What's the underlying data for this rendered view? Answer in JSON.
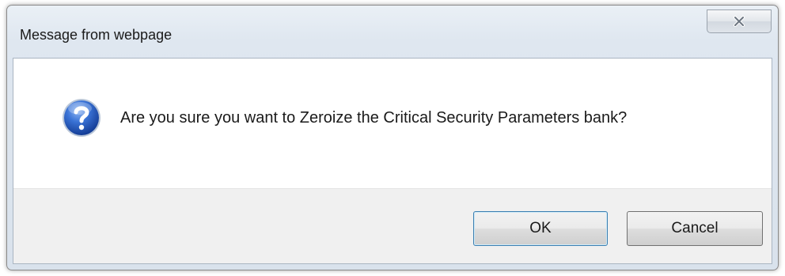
{
  "window": {
    "title": "Message from webpage"
  },
  "dialog": {
    "icon": "question-icon",
    "message": "Are you sure you want to Zeroize the Critical Security Parameters bank?"
  },
  "buttons": {
    "ok_label": "OK",
    "cancel_label": "Cancel"
  },
  "colors": {
    "icon_blue": "#2a62c9",
    "frame": "#dfe7f0",
    "button_area": "#f0f0f0"
  }
}
